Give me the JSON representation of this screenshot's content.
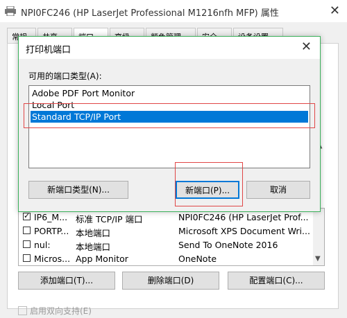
{
  "window": {
    "title": "NPI0FC246 (HP LaserJet Professional M1216nfh MFP) 属性",
    "close_glyph": "✕"
  },
  "tabs": [
    "常规",
    "共享",
    "端口",
    "高级",
    "颜色管理",
    "安全",
    "设备设置"
  ],
  "ports": [
    {
      "checked": true,
      "port": "IP6_M...",
      "description": "标准 TCP/IP 端口",
      "printer": "NPI0FC246 (HP LaserJet Prof..."
    },
    {
      "checked": false,
      "port": "PORTP...",
      "description": "本地端口",
      "printer": "Microsoft XPS Document Wri..."
    },
    {
      "checked": false,
      "port": "nul:",
      "description": "本地端口",
      "printer": "Send To OneNote 2016"
    },
    {
      "checked": false,
      "port": "Micros...",
      "description": "App Monitor",
      "printer": "OneNote"
    }
  ],
  "buttons": {
    "add_port": "添加端口(T)...",
    "delete_port": "删除端口(D)",
    "configure_port": "配置端口(C)..."
  },
  "bidi": "启用双向支持(E)",
  "dialog": {
    "title": "打印机端口",
    "types_label": "可用的端口类型(A):",
    "port_types": [
      "Adobe PDF Port Monitor",
      "Local Port",
      "Standard TCP/IP Port"
    ],
    "selected_index": 2,
    "new_type_button": "新端口类型(N)...",
    "new_port_button": "新端口(P)...",
    "cancel_button": "取消"
  },
  "colors": {
    "accent": "#0078d7",
    "highlight_box": "#e04646",
    "dialog_border": "#3ab15a"
  }
}
